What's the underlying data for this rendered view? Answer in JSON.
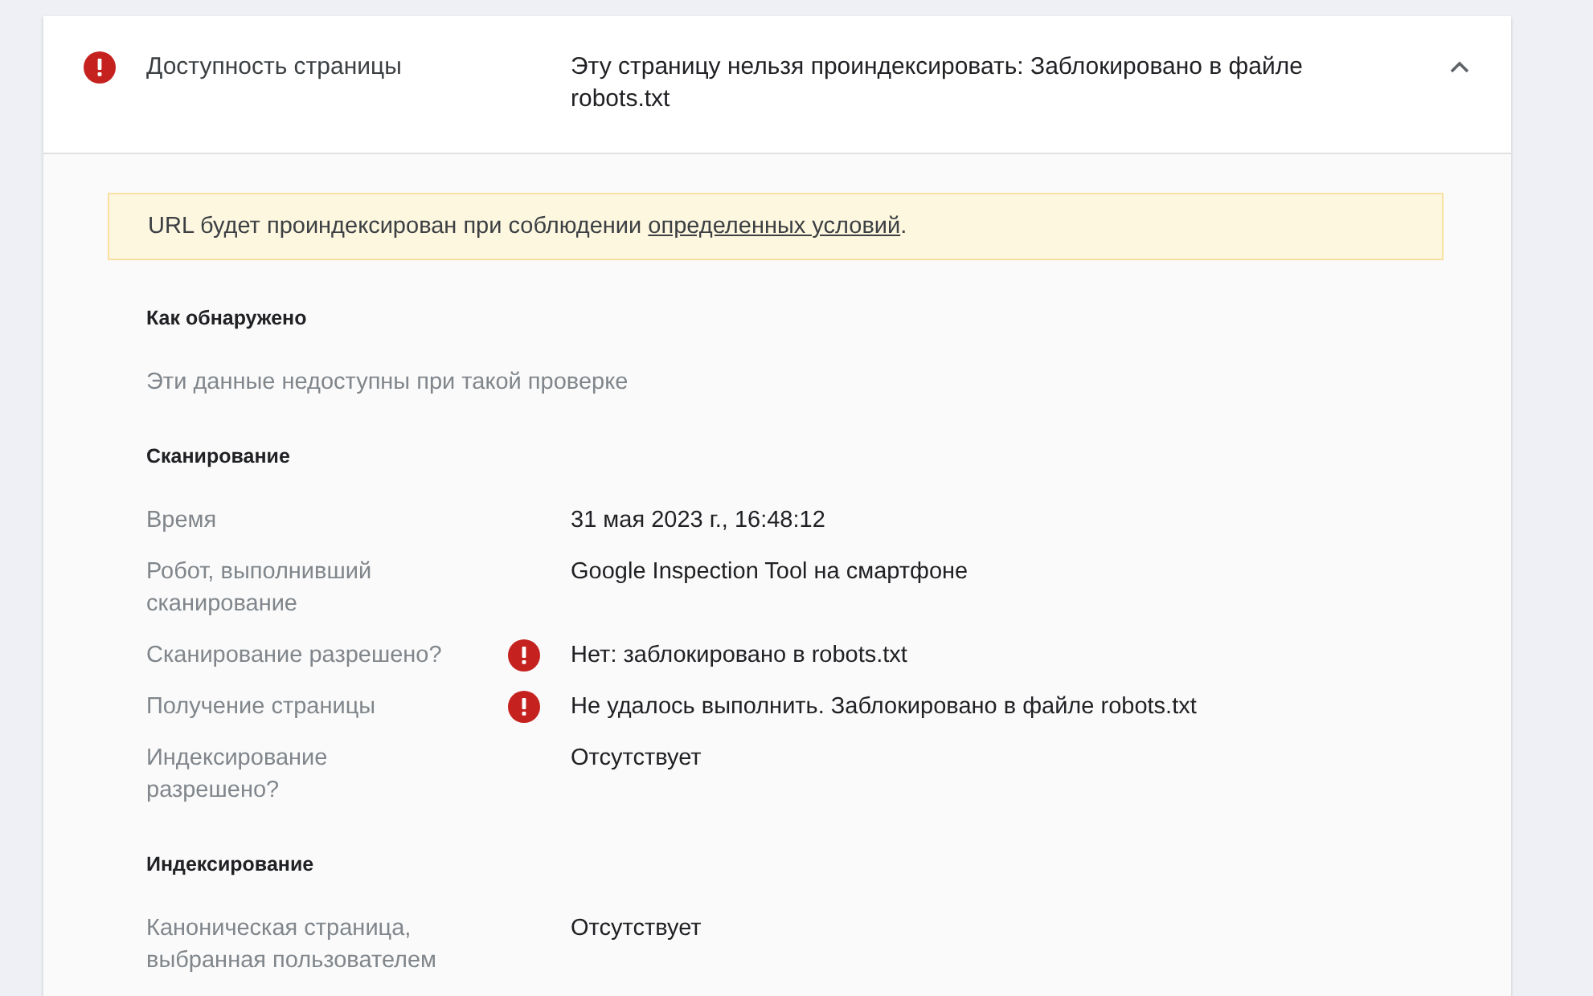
{
  "header": {
    "error": true,
    "label": "Доступность страницы",
    "value": "Эту страницу нельзя проиндексировать: Заблокировано в файле robots.txt",
    "expanded": true
  },
  "banner": {
    "text_before": "URL будет проиндексирован при соблюдении ",
    "link": "определенных условий",
    "text_after": "."
  },
  "sections": [
    {
      "title": "Как обнаружено",
      "note": "Эти данные недоступны при такой проверке"
    },
    {
      "title": "Сканирование",
      "rows": [
        {
          "label": "Время",
          "error": false,
          "value": "31 мая 2023 г., 16:48:12"
        },
        {
          "label": "Робот, выполнивший сканирование",
          "error": false,
          "value": "Google Inspection Tool на смартфоне"
        },
        {
          "label": "Сканирование разрешено?",
          "error": true,
          "value": "Нет: заблокировано в robots.txt"
        },
        {
          "label": "Получение страницы",
          "error": true,
          "value": "Не удалось выполнить. Заблокировано в файле robots.txt"
        },
        {
          "label": "Индексирование разрешено?",
          "error": false,
          "value": "Отсутствует"
        }
      ]
    },
    {
      "title": "Индексирование",
      "rows": [
        {
          "label": "Каноническая страница, выбранная пользователем",
          "error": false,
          "value": "Отсутствует"
        }
      ]
    }
  ]
}
